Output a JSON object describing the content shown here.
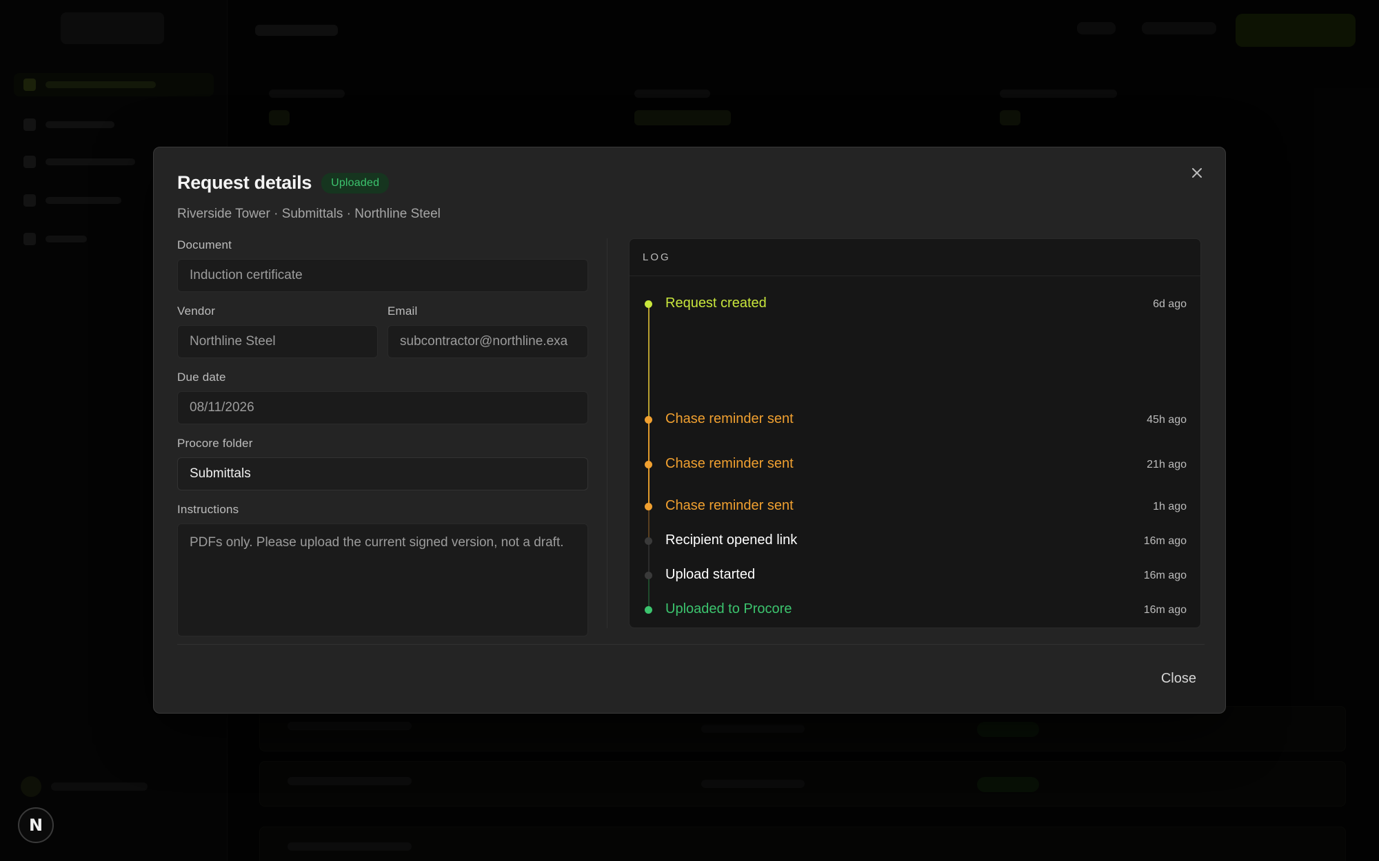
{
  "modal": {
    "title": "Request details",
    "status_badge": "Uploaded",
    "subtitle": "Riverside Tower · Submittals · Northline Steel",
    "close_icon": "close-icon",
    "close_label": "Close"
  },
  "form": {
    "document": {
      "label": "Document",
      "value": "Induction certificate"
    },
    "vendor": {
      "label": "Vendor",
      "value": "Northline Steel"
    },
    "email": {
      "label": "Email",
      "value": "subcontractor@northline.exa"
    },
    "due_date": {
      "label": "Due date",
      "value": "08/11/2026"
    },
    "procore_folder": {
      "label": "Procore folder",
      "value": "Submittals"
    },
    "instructions": {
      "label": "Instructions",
      "value": "PDFs only. Please upload the current signed version, not a draft."
    }
  },
  "log": {
    "heading": "LOG",
    "entries": [
      {
        "text": "Request created",
        "time": "6d ago",
        "color": "#c8e63c"
      },
      {
        "text": "Chase reminder sent",
        "time": "45h ago",
        "color": "#f0a030"
      },
      {
        "text": "Chase reminder sent",
        "time": "21h ago",
        "color": "#f0a030"
      },
      {
        "text": "Chase reminder sent",
        "time": "1h ago",
        "color": "#f0a030"
      },
      {
        "text": "Recipient opened link",
        "time": "16m ago",
        "color": "#ffffff"
      },
      {
        "text": "Upload started",
        "time": "16m ago",
        "color": "#ffffff"
      },
      {
        "text": "Uploaded to Procore",
        "time": "16m ago",
        "color": "#3cc46e"
      }
    ]
  },
  "corner_badge": "N",
  "colors": {
    "accent_lime": "#c8e63c",
    "warning_orange": "#f0a030",
    "success_green": "#3cc46e",
    "modal_bg": "#242424"
  }
}
